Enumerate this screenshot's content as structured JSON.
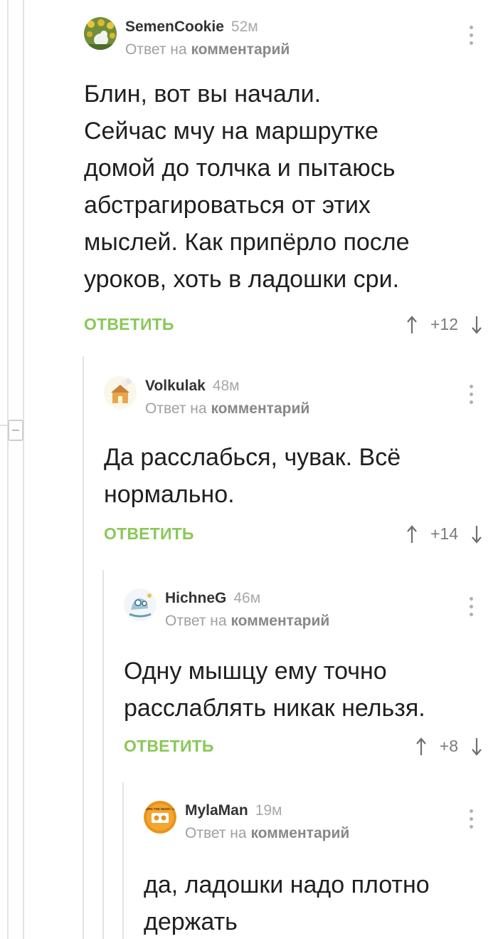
{
  "comments": [
    {
      "author": "SemenCookie",
      "time": "52м",
      "reply_prefix": "Ответ на",
      "reply_target": "комментарий",
      "text": "Блин, вот вы начали.\nСейчас мчу на маршрутке\nдомой до толчка и пытаюсь\nабстрагироваться от этих\nмыслей. Как припёрло после\nуроков, хоть в ладошки сри.",
      "reply_label": "ОТВЕТИТЬ",
      "rating": "+12"
    },
    {
      "author": "Volkulak",
      "time": "48м",
      "reply_prefix": "Ответ на",
      "reply_target": "комментарий",
      "text": "Да расслабься, чувак. Всё\nнормально.",
      "reply_label": "ОТВЕТИТЬ",
      "rating": "+14"
    },
    {
      "author": "HichneG",
      "time": "46м",
      "reply_prefix": "Ответ на",
      "reply_target": "комментарий",
      "text": "Одну мышцу ему точно\nрасслаблять никак нельзя.",
      "reply_label": "ОТВЕТИТЬ",
      "rating": "+8"
    },
    {
      "author": "MylaMan",
      "time": "19м",
      "reply_prefix": "Ответ на",
      "reply_target": "комментарий",
      "text": "да, ладошки надо плотно\nдержать",
      "avatar_text": "TURN THE MUSIC UP"
    }
  ],
  "colors": {
    "accent": "#8ac858",
    "thread_line": "#e3e3e3",
    "muted": "#a0a0a0"
  }
}
